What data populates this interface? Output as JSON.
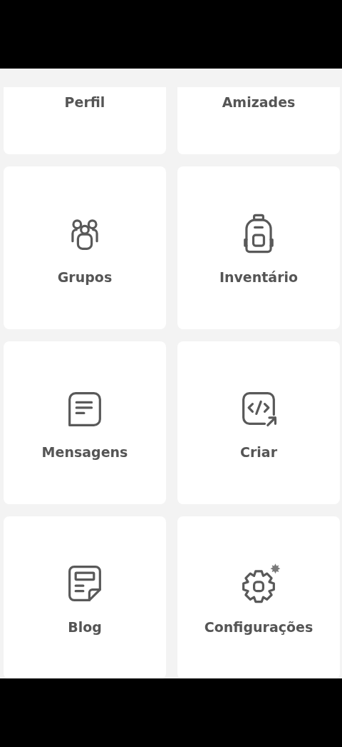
{
  "menu_tiles": [
    {
      "label": "Perfil"
    },
    {
      "label": "Amizades"
    },
    {
      "label": "Grupos"
    },
    {
      "label": "Inventário"
    },
    {
      "label": "Mensagens"
    },
    {
      "label": "Criar"
    },
    {
      "label": "Blog"
    },
    {
      "label": "Configurações"
    }
  ]
}
